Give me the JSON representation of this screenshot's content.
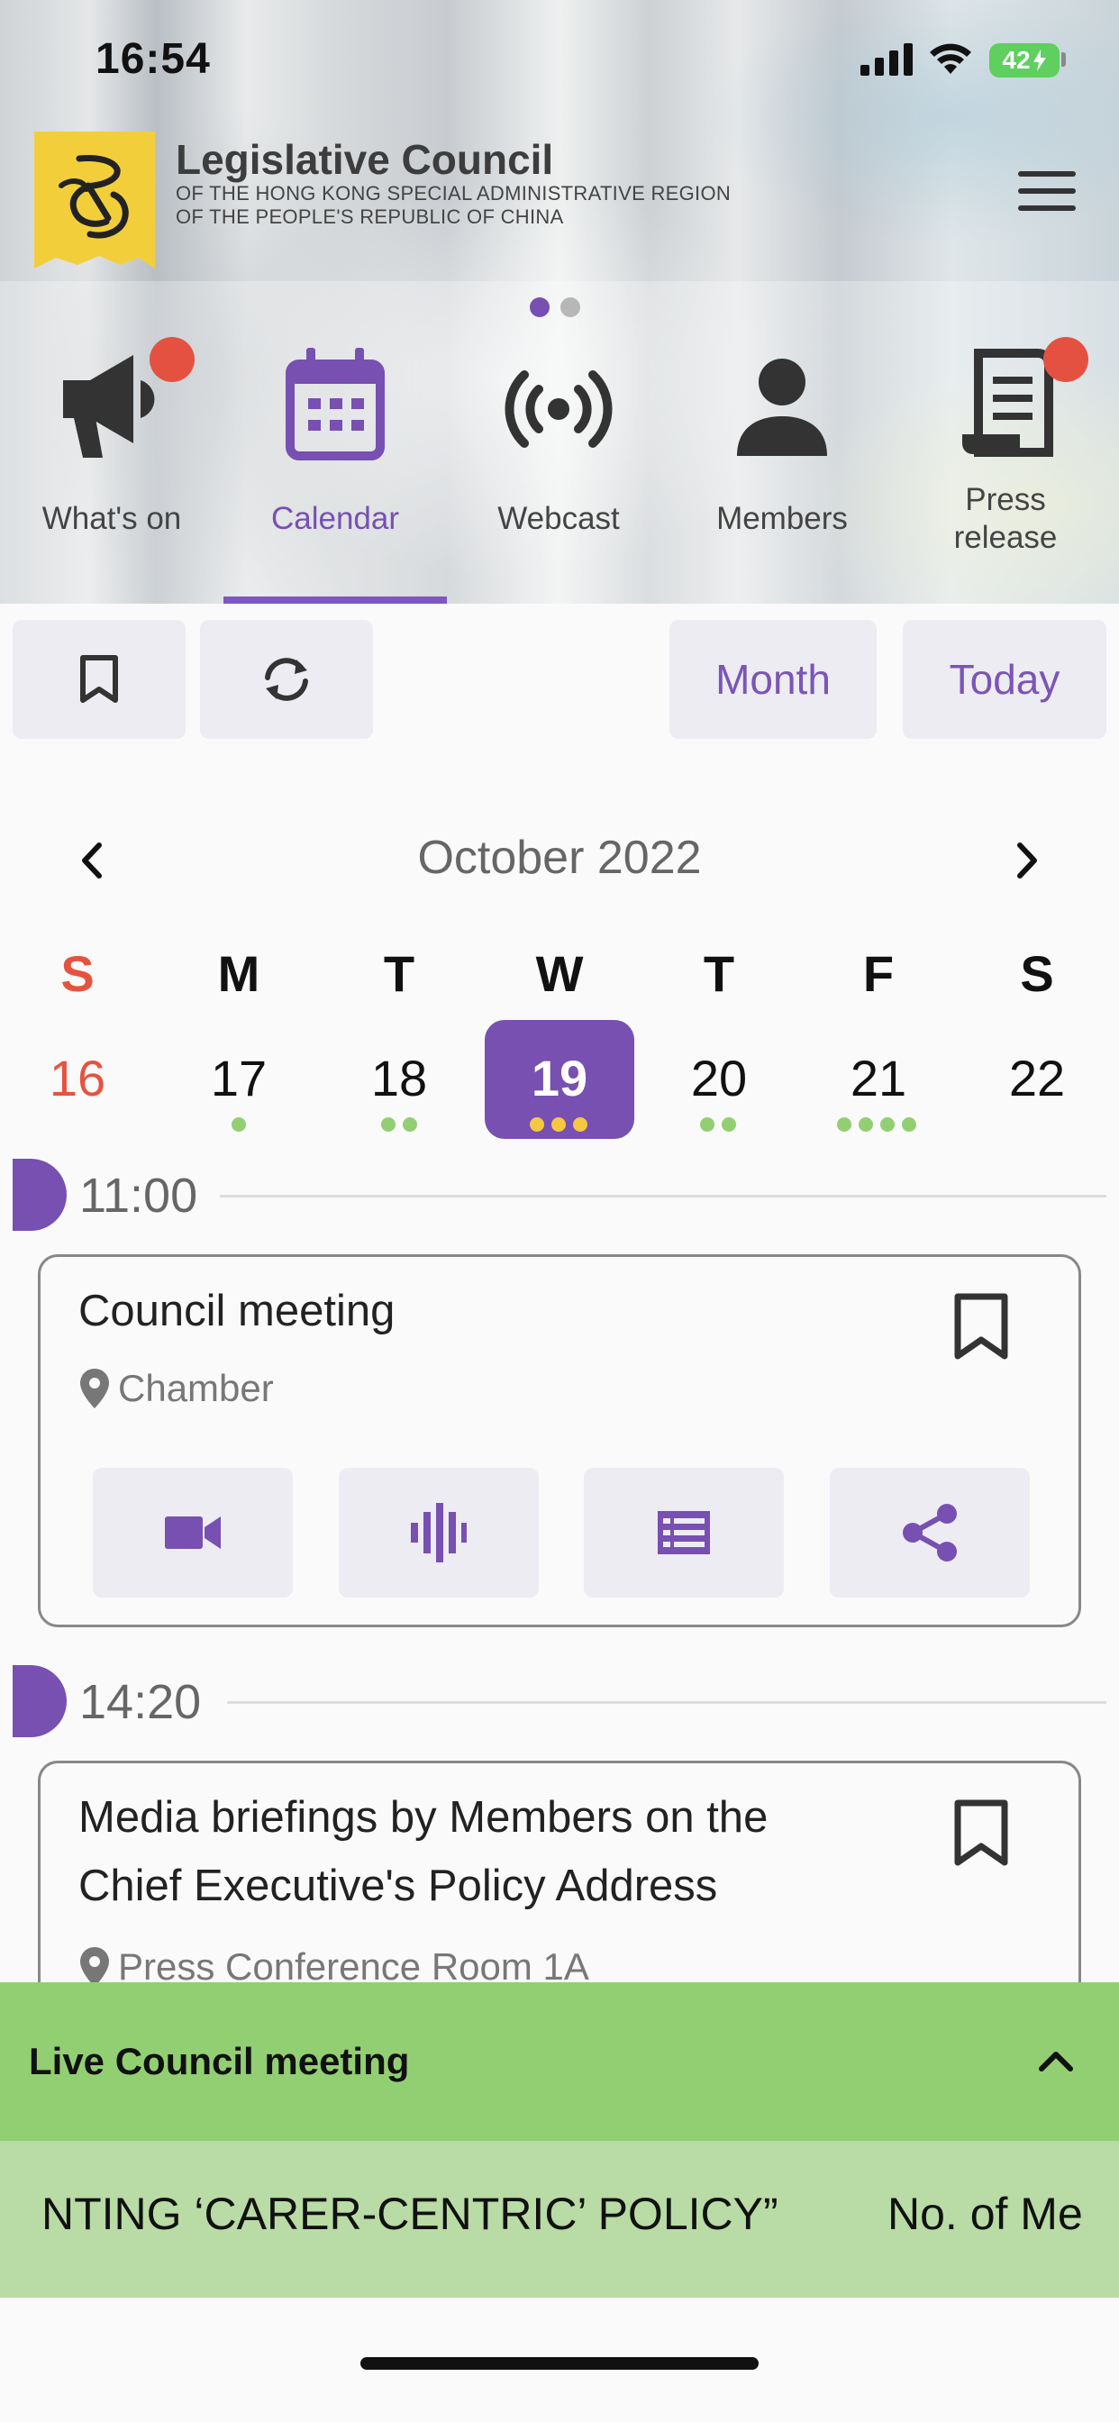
{
  "status_bar": {
    "time": "16:54",
    "battery": "42"
  },
  "header": {
    "title": "Legislative Council",
    "subtitle_line1": "OF THE HONG KONG SPECIAL ADMINISTRATIVE REGION",
    "subtitle_line2": "OF THE PEOPLE'S REPUBLIC OF CHINA"
  },
  "nav": {
    "items": [
      {
        "label": "What's on",
        "icon": "megaphone-icon",
        "badge": true
      },
      {
        "label": "Calendar",
        "icon": "calendar-icon",
        "active": true
      },
      {
        "label": "Webcast",
        "icon": "broadcast-icon"
      },
      {
        "label": "Members",
        "icon": "person-icon"
      },
      {
        "label_line1": "Press",
        "label_line2": "release",
        "icon": "document-icon",
        "badge": true
      }
    ]
  },
  "toolbar": {
    "bookmark_icon": "bookmark-outline-icon",
    "refresh_icon": "sync-icon",
    "month_label": "Month",
    "today_label": "Today"
  },
  "calendar": {
    "month_title": "October 2022",
    "weekdays": [
      "S",
      "M",
      "T",
      "W",
      "T",
      "F",
      "S"
    ],
    "days": [
      "16",
      "17",
      "18",
      "19",
      "20",
      "21",
      "22"
    ],
    "selected_day": "19",
    "event_counts": [
      0,
      1,
      2,
      3,
      2,
      4,
      0
    ]
  },
  "events": [
    {
      "time": "11:00",
      "title": "Council meeting",
      "location": "Chamber",
      "actions": [
        "video-icon",
        "audio-icon",
        "agenda-list-icon",
        "share-icon"
      ]
    },
    {
      "time": "14:20",
      "title_line1": "Media briefings by Members on the",
      "title_line2": "Chief Executive's Policy Address",
      "location": "Press Conference Room 1A"
    }
  ],
  "live_bar": {
    "title": "Live Council meeting",
    "ticker_text": "NTING ‘CARER-CENTRIC’ POLICY”",
    "ticker_text2": "No. of Me"
  },
  "colors": {
    "accent": "#7750b2",
    "sunday": "#e5533f",
    "badge": "#e55141",
    "dot_green": "#92cf72",
    "dot_yellow": "#f5c842",
    "live_bar": "#92cf72",
    "ticker": "#b9dba5"
  }
}
